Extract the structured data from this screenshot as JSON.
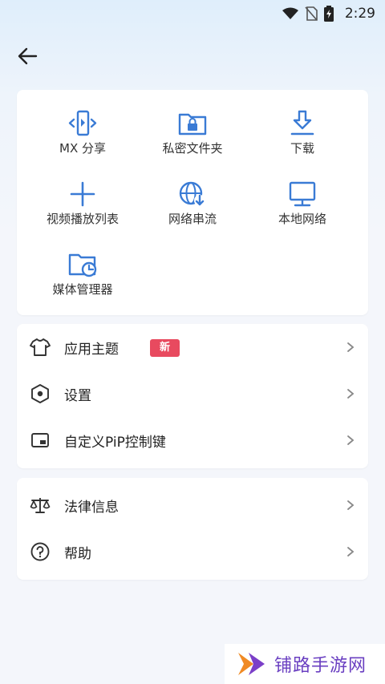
{
  "status_bar": {
    "time": "2:29"
  },
  "grid": [
    {
      "label": "MX 分享",
      "icon": "mx-share-icon"
    },
    {
      "label": "私密文件夹",
      "icon": "private-folder-icon"
    },
    {
      "label": "下载",
      "icon": "download-icon"
    },
    {
      "label": "视频播放列表",
      "icon": "add-playlist-icon"
    },
    {
      "label": "网络串流",
      "icon": "network-stream-icon"
    },
    {
      "label": "本地网络",
      "icon": "local-network-icon"
    },
    {
      "label": "媒体管理器",
      "icon": "media-manager-icon"
    }
  ],
  "menu1": [
    {
      "label": "应用主题",
      "icon": "shirt-icon",
      "badge": "新"
    },
    {
      "label": "设置",
      "icon": "hexagon-settings-icon"
    },
    {
      "label": "自定义PiP控制键",
      "icon": "pip-icon"
    }
  ],
  "menu2": [
    {
      "label": "法律信息",
      "icon": "scale-icon"
    },
    {
      "label": "帮助",
      "icon": "help-icon"
    }
  ],
  "colors": {
    "accent": "#3a7bd5",
    "badge": "#e84a5f",
    "watermark": "#6a3fc1"
  },
  "watermark": {
    "text": "铺路手游网"
  }
}
